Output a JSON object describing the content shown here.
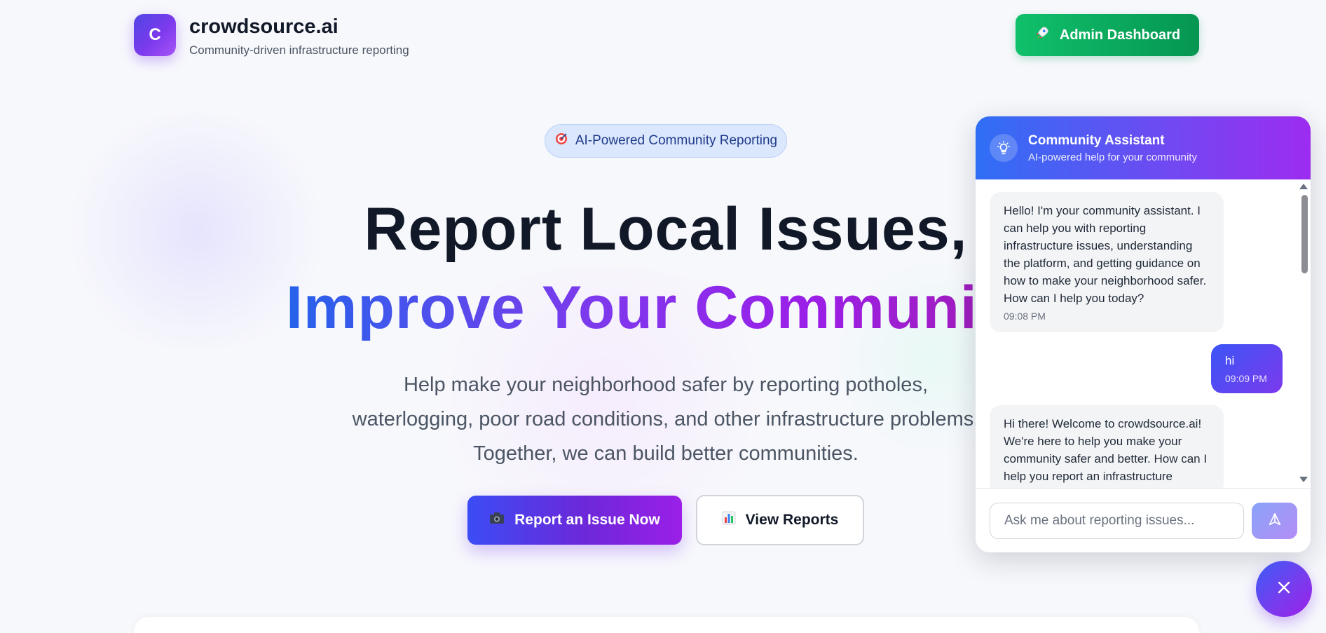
{
  "header": {
    "logo_letter": "C",
    "brand_name": "crowdsource.ai",
    "tagline": "Community-driven infrastructure reporting",
    "admin_button_label": "Admin Dashboard",
    "admin_button_icon": "rocket-icon"
  },
  "hero": {
    "badge_icon": "target-icon",
    "badge_label": "AI-Powered Community Reporting",
    "title_line1": "Report Local Issues,",
    "title_line2": "Improve Your Community",
    "subtitle_line1": "Help make your neighborhood safer by reporting potholes,",
    "subtitle_line2": "waterlogging, poor road conditions, and other infrastructure problems.",
    "subtitle_line3": "Together, we can build better communities.",
    "primary_button_icon": "camera-icon",
    "primary_button_label": "Report an Issue Now",
    "secondary_button_icon": "bar-chart-icon",
    "secondary_button_label": "View Reports"
  },
  "chat": {
    "title": "Community Assistant",
    "subtitle": "AI-powered help for your community",
    "header_icon": "lightbulb-icon",
    "messages": [
      {
        "role": "assistant",
        "text": "Hello! I'm your community assistant. I can help you with reporting infrastructure issues, understanding the platform, and getting guidance on how to make your neighborhood safer. How can I help you today?",
        "time": "09:08 PM"
      },
      {
        "role": "user",
        "text": "hi",
        "time": "09:09 PM"
      },
      {
        "role": "assistant",
        "text": "Hi there! Welcome to crowdsource.ai! We're here to help you make your community safer and better. How can I help you report an infrastructure",
        "time": ""
      }
    ],
    "input_placeholder": "Ask me about reporting issues...",
    "input_value": "",
    "send_icon": "send-icon",
    "close_icon": "close-icon"
  },
  "colors": {
    "brand_purple": "#7c3aed",
    "brand_blue": "#2563eb",
    "admin_green": "#059652",
    "badge_bg": "#dbe7fd"
  }
}
